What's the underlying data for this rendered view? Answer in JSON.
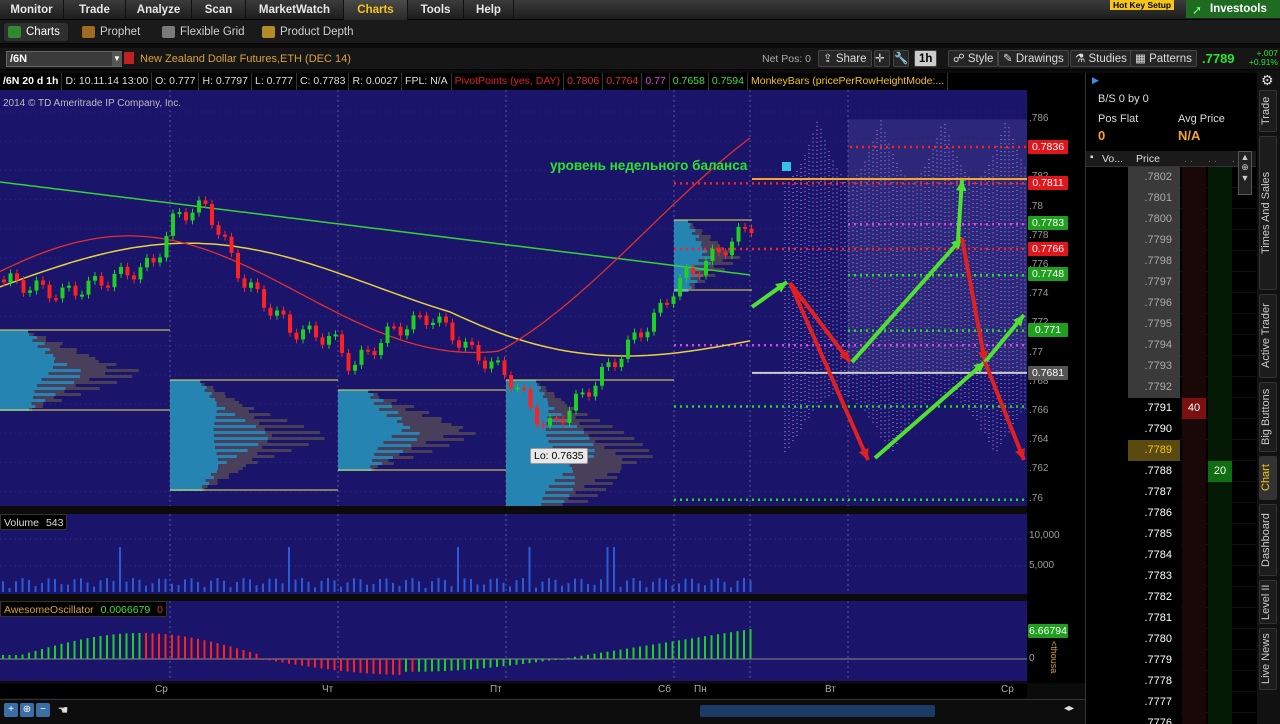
{
  "top_nav": {
    "tabs": [
      "Monitor",
      "Trade",
      "Analyze",
      "Scan",
      "MarketWatch",
      "Charts",
      "Tools",
      "Help"
    ],
    "active": "Charts",
    "hot_key": "Hot Key Setup",
    "brand": "Investools"
  },
  "sub_nav": {
    "tabs": [
      "Charts",
      "Prophet",
      "Flexible Grid",
      "Product Depth"
    ],
    "active": "Charts"
  },
  "header": {
    "symbol": "/6N",
    "description": "New Zealand Dollar Futures,ETH (DEC 14)",
    "net_pos": "Net Pos: 0",
    "share": "Share",
    "timeframe": "1h",
    "style": "Style",
    "drawings": "Drawings",
    "studies": "Studies",
    "patterns": "Patterns",
    "last_price": ".7789",
    "change": "+.007",
    "change_pct": "+0.91%"
  },
  "info_bar": {
    "symbol_tf": "/6N 20 d 1h",
    "date": "D: 10.11.14 13:00",
    "open": "O: 0.777",
    "high": "H: 0.7797",
    "low": "L: 0.777",
    "close": "C: 0.7783",
    "range": "R: 0.0027",
    "fpl": "FPL: N/A",
    "pivot_label": "PivotPoints (yes, DAY)",
    "pivot_values": [
      "0.7806",
      "0.7764",
      "0.77",
      "0.7658",
      "0.7594"
    ],
    "monkey": "MonkeyBars (pricePerRowHeightMode:..."
  },
  "chart": {
    "copyright": "2014 © TD Ameritrade IP Company, Inc.",
    "annotation": "уровень недельного баланса",
    "low_label": "Lo: 0.7635",
    "axis_ticks": [
      ".786",
      ".784",
      ".782",
      ".78",
      ".778",
      ".776",
      ".774",
      ".772",
      ".77",
      ".768",
      ".766",
      ".764",
      ".762",
      ".76"
    ],
    "price_tags": [
      {
        "label": "0.7836",
        "color": "#e0161b"
      },
      {
        "label": "0.7811",
        "color": "#e0161b"
      },
      {
        "label": "0.7783",
        "color": "#1f9e1f"
      },
      {
        "label": "0.7766",
        "color": "#e0161b"
      },
      {
        "label": "0.7748",
        "color": "#1f9e1f"
      },
      {
        "label": "0.771",
        "color": "#1f9e1f"
      },
      {
        "label": "0.7681",
        "color": "#555555"
      }
    ],
    "time_labels": [
      "Ср",
      "Чт",
      "Пт",
      "Сб",
      "Пн",
      "Вт",
      "Ср"
    ]
  },
  "volume": {
    "label": "Volume",
    "value": "543",
    "ticks": [
      "10,000",
      "5,000"
    ]
  },
  "oscillator": {
    "label": "AwesomeOscillator",
    "value": "0.0066679",
    "zero": "0",
    "tag": "6.66794",
    "tick0": "0",
    "unit": "<thousa"
  },
  "dom": {
    "bs": "B/S 0 by 0",
    "pos_flat_label": "Pos Flat",
    "pos_flat_value": "0",
    "avg_price_label": "Avg Price",
    "avg_price_value": "N/A",
    "col_vol": "Vo...",
    "col_price": "Price",
    "rows": [
      {
        "price": ".7802",
        "bid": "",
        "ask": ""
      },
      {
        "price": ".7801",
        "bid": "",
        "ask": ""
      },
      {
        "price": ".7800",
        "bid": "",
        "ask": ""
      },
      {
        "price": ".7799",
        "bid": "",
        "ask": ""
      },
      {
        "price": ".7798",
        "bid": "",
        "ask": ""
      },
      {
        "price": ".7797",
        "bid": "",
        "ask": ""
      },
      {
        "price": ".7796",
        "bid": "",
        "ask": ""
      },
      {
        "price": ".7795",
        "bid": "",
        "ask": ""
      },
      {
        "price": ".7794",
        "bid": "",
        "ask": ""
      },
      {
        "price": ".7793",
        "bid": "",
        "ask": ""
      },
      {
        "price": ".7792",
        "bid": "",
        "ask": ""
      },
      {
        "price": ".7791",
        "bid": "40",
        "ask": ""
      },
      {
        "price": ".7790",
        "bid": "",
        "ask": ""
      },
      {
        "price": ".7789",
        "bid": "",
        "ask": ""
      },
      {
        "price": ".7788",
        "bid": "",
        "ask": "20"
      },
      {
        "price": ".7787",
        "bid": "",
        "ask": ""
      },
      {
        "price": ".7786",
        "bid": "",
        "ask": ""
      },
      {
        "price": ".7785",
        "bid": "",
        "ask": ""
      },
      {
        "price": ".7784",
        "bid": "",
        "ask": ""
      },
      {
        "price": ".7783",
        "bid": "",
        "ask": ""
      },
      {
        "price": ".7782",
        "bid": "",
        "ask": ""
      },
      {
        "price": ".7781",
        "bid": "",
        "ask": ""
      },
      {
        "price": ".7780",
        "bid": "",
        "ask": ""
      },
      {
        "price": ".7779",
        "bid": "",
        "ask": ""
      },
      {
        "price": ".7778",
        "bid": "",
        "ask": ""
      },
      {
        "price": ".7777",
        "bid": "",
        "ask": ""
      },
      {
        "price": ".7776",
        "bid": "",
        "ask": ""
      }
    ]
  },
  "side_tabs": [
    "Trade",
    "Times And Sales",
    "Active Trader",
    "Big Buttons",
    "Chart",
    "Dashboard",
    "Level II",
    "Live News"
  ],
  "side_active": "Chart"
}
